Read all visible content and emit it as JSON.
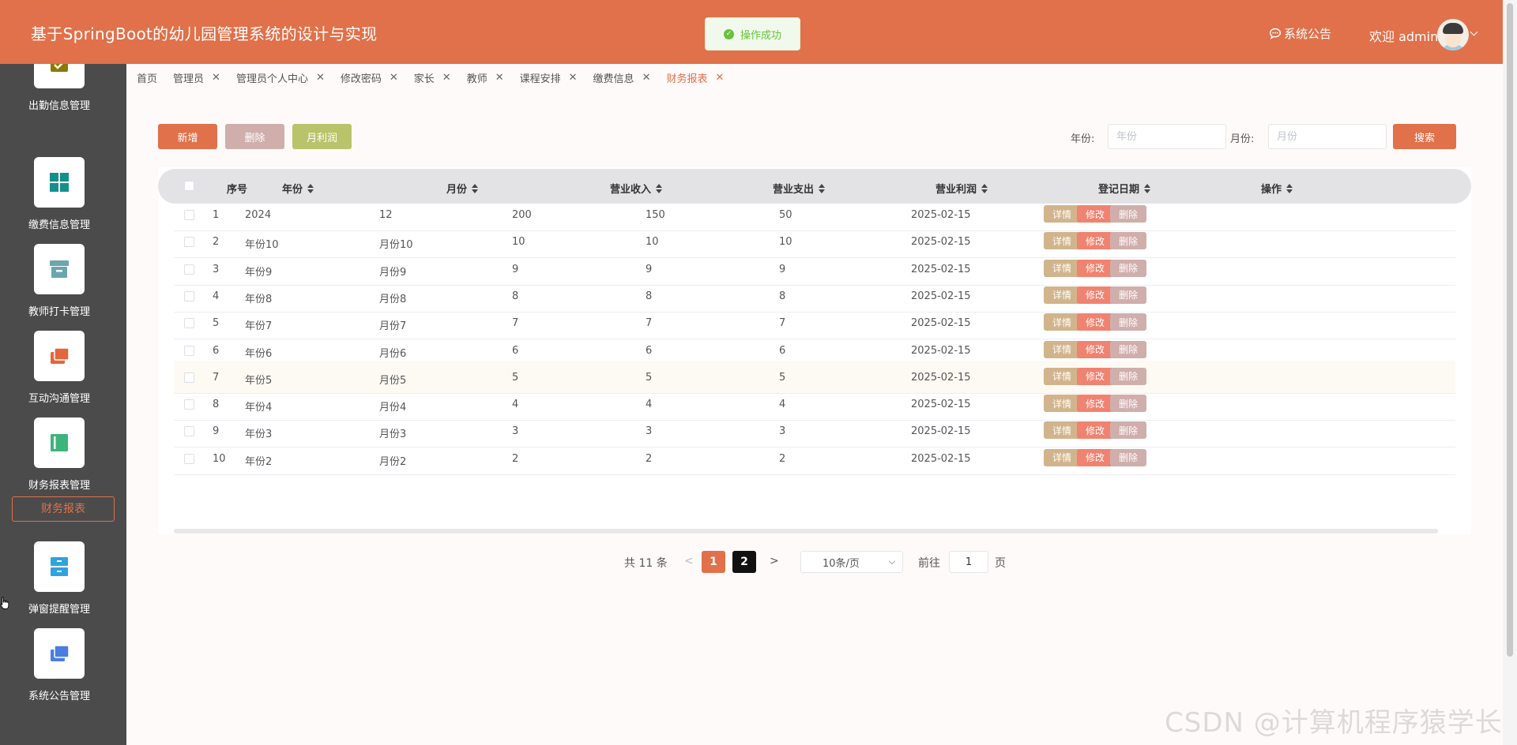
{
  "header": {
    "title": "基于SpringBoot的幼儿园管理系统的设计与实现",
    "toast": "操作成功",
    "notice": "系统公告",
    "welcome": "欢迎 admin"
  },
  "sidebar": {
    "items": [
      {
        "label": "出勤信息管理",
        "icon": "calendar-icon"
      },
      {
        "label": "缴费信息管理",
        "icon": "grid-icon"
      },
      {
        "label": "教师打卡管理",
        "icon": "archive-box-icon"
      },
      {
        "label": "互动沟通管理",
        "icon": "folders-icon"
      },
      {
        "label": "财务报表管理",
        "icon": "book-icon"
      },
      {
        "label": "弹窗提醒管理",
        "icon": "drawer-icon"
      },
      {
        "label": "系统公告管理",
        "icon": "folders-icon"
      }
    ],
    "submenu": "财务报表"
  },
  "tabs": [
    {
      "label": "首页",
      "closable": false
    },
    {
      "label": "管理员",
      "closable": true
    },
    {
      "label": "管理员个人中心",
      "closable": true
    },
    {
      "label": "修改密码",
      "closable": true
    },
    {
      "label": "家长",
      "closable": true
    },
    {
      "label": "教师",
      "closable": true
    },
    {
      "label": "课程安排",
      "closable": true
    },
    {
      "label": "缴费信息",
      "closable": true
    },
    {
      "label": "财务报表",
      "closable": true,
      "active": true
    }
  ],
  "toolbar": {
    "add": "新增",
    "delete": "删除",
    "monthly_profit": "月利润",
    "year_label": "年份:",
    "year_placeholder": "年份",
    "month_label": "月份:",
    "month_placeholder": "月份",
    "search": "搜索"
  },
  "table": {
    "columns": [
      "序号",
      "年份",
      "月份",
      "营业收入",
      "营业支出",
      "营业利润",
      "登记日期",
      "操作"
    ],
    "actions": {
      "detail": "详情",
      "edit": "修改",
      "delete": "删除"
    },
    "rows": [
      [
        "1",
        "2024",
        "12",
        "200",
        "150",
        "50",
        "2025-02-15"
      ],
      [
        "2",
        "年份10",
        "月份10",
        "10",
        "10",
        "10",
        "2025-02-15"
      ],
      [
        "3",
        "年份9",
        "月份9",
        "9",
        "9",
        "9",
        "2025-02-15"
      ],
      [
        "4",
        "年份8",
        "月份8",
        "8",
        "8",
        "8",
        "2025-02-15"
      ],
      [
        "5",
        "年份7",
        "月份7",
        "7",
        "7",
        "7",
        "2025-02-15"
      ],
      [
        "6",
        "年份6",
        "月份6",
        "6",
        "6",
        "6",
        "2025-02-15"
      ],
      [
        "7",
        "年份5",
        "月份5",
        "5",
        "5",
        "5",
        "2025-02-15"
      ],
      [
        "8",
        "年份4",
        "月份4",
        "4",
        "4",
        "4",
        "2025-02-15"
      ],
      [
        "9",
        "年份3",
        "月份3",
        "3",
        "3",
        "3",
        "2025-02-15"
      ],
      [
        "10",
        "年份2",
        "月份2",
        "2",
        "2",
        "2",
        "2025-02-15"
      ]
    ]
  },
  "pagination": {
    "total": "共 11 条",
    "prev": "<",
    "next": ">",
    "pages": [
      "1",
      "2"
    ],
    "current": "1",
    "page_size": "10条/页",
    "goto_label": "前往",
    "goto_value": "1",
    "page_unit": "页"
  },
  "watermark": "CSDN @计算机程序猿学长",
  "colors": {
    "primary": "#e0714a",
    "sidebar": "#4b4b4b",
    "success": "#67c23a"
  }
}
